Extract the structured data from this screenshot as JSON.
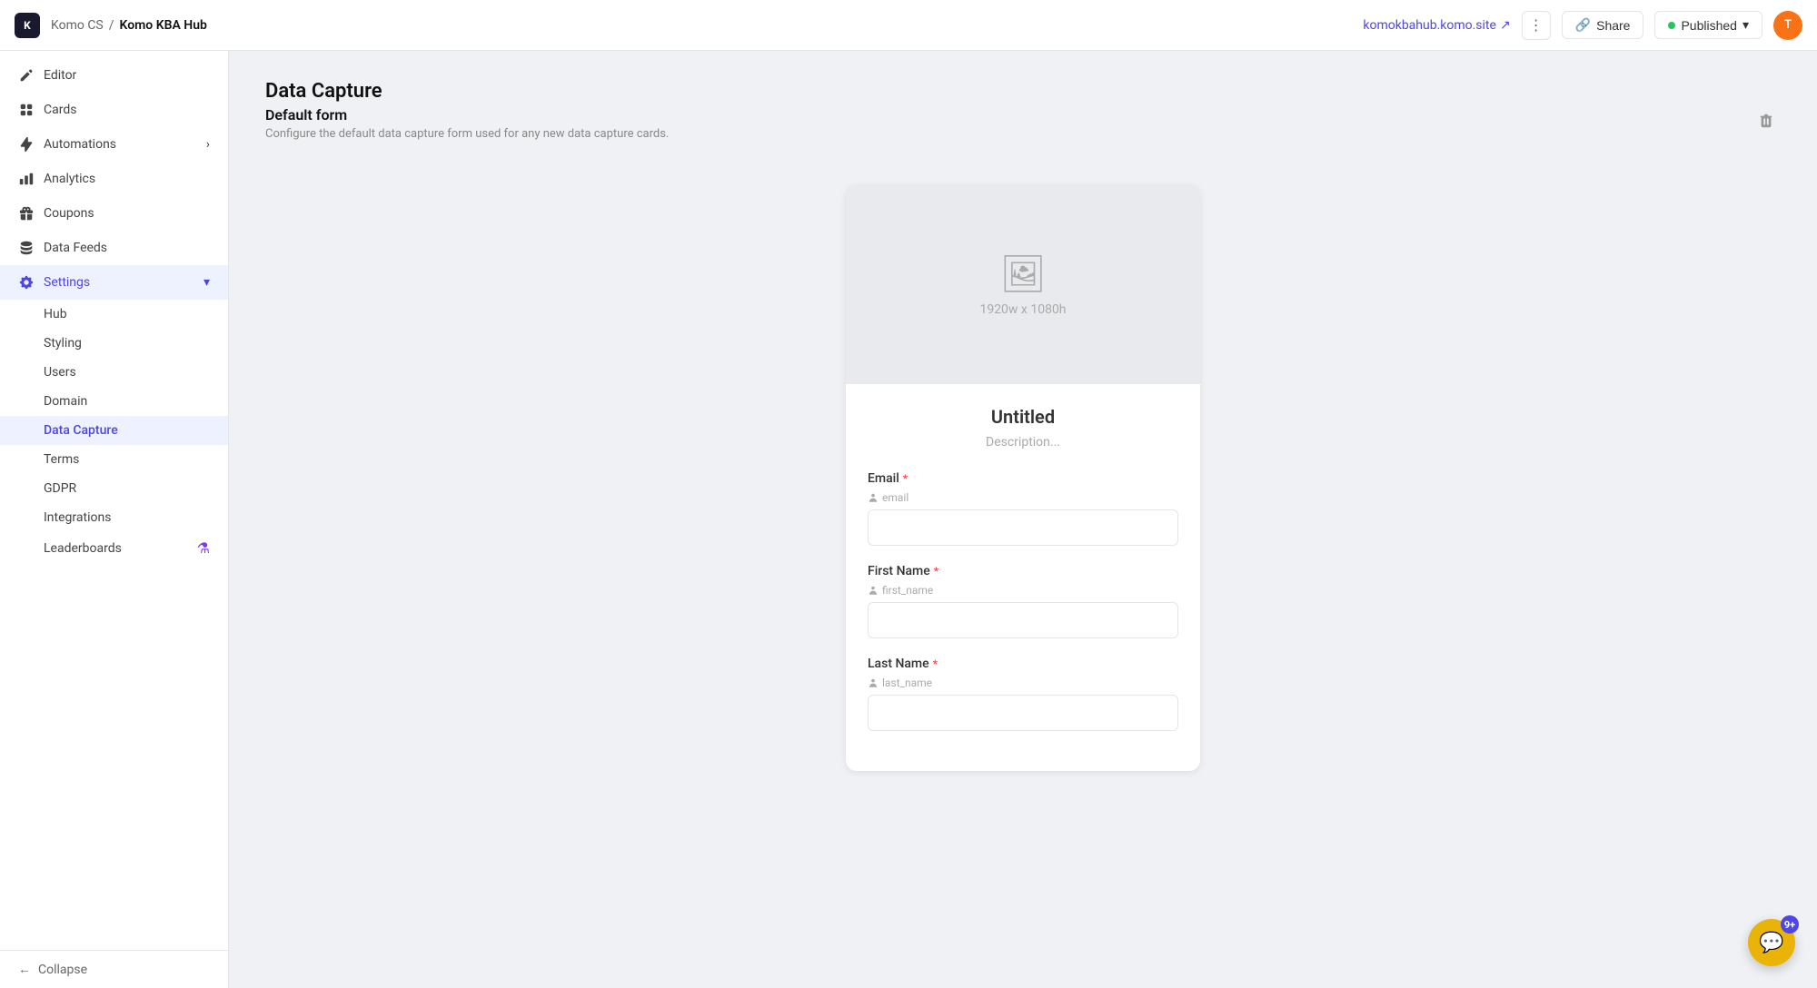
{
  "topbar": {
    "logo": "K",
    "breadcrumb_parent": "Komo CS",
    "breadcrumb_separator": "/",
    "breadcrumb_current": "Komo KBA Hub",
    "site_link": "komokbahub.komo.site",
    "more_label": "⋮",
    "share_label": "Share",
    "published_label": "Published",
    "avatar_label": "T"
  },
  "sidebar": {
    "items": [
      {
        "id": "editor",
        "label": "Editor",
        "icon": "editor"
      },
      {
        "id": "cards",
        "label": "Cards",
        "icon": "cards"
      },
      {
        "id": "automations",
        "label": "Automations",
        "icon": "automations",
        "has_chevron": true
      },
      {
        "id": "analytics",
        "label": "Analytics",
        "icon": "analytics"
      },
      {
        "id": "coupons",
        "label": "Coupons",
        "icon": "coupons"
      },
      {
        "id": "data-feeds",
        "label": "Data Feeds",
        "icon": "data-feeds"
      },
      {
        "id": "settings",
        "label": "Settings",
        "icon": "settings",
        "active": true,
        "expanded": true
      }
    ],
    "subitems": [
      {
        "id": "hub",
        "label": "Hub"
      },
      {
        "id": "styling",
        "label": "Styling"
      },
      {
        "id": "users",
        "label": "Users"
      },
      {
        "id": "domain",
        "label": "Domain"
      },
      {
        "id": "data-capture",
        "label": "Data Capture",
        "active": true
      },
      {
        "id": "terms",
        "label": "Terms"
      },
      {
        "id": "gdpr",
        "label": "GDPR"
      },
      {
        "id": "integrations",
        "label": "Integrations"
      },
      {
        "id": "leaderboards",
        "label": "Leaderboards",
        "has_beta": true
      }
    ],
    "collapse_label": "Collapse"
  },
  "main": {
    "page_title": "Data Capture",
    "section_title": "Default form",
    "section_desc": "Configure the default data capture form used for any new data capture cards.",
    "form_preview": {
      "image_size": "1920w x 1080h",
      "title": "Untitled",
      "description": "Description...",
      "fields": [
        {
          "label": "Email",
          "required": true,
          "hint": "email",
          "placeholder": ""
        },
        {
          "label": "First Name",
          "required": true,
          "hint": "first_name",
          "placeholder": ""
        },
        {
          "label": "Last Name",
          "required": true,
          "hint": "last_name",
          "placeholder": ""
        }
      ]
    }
  },
  "chat": {
    "count": "9+",
    "icon": "💬"
  }
}
